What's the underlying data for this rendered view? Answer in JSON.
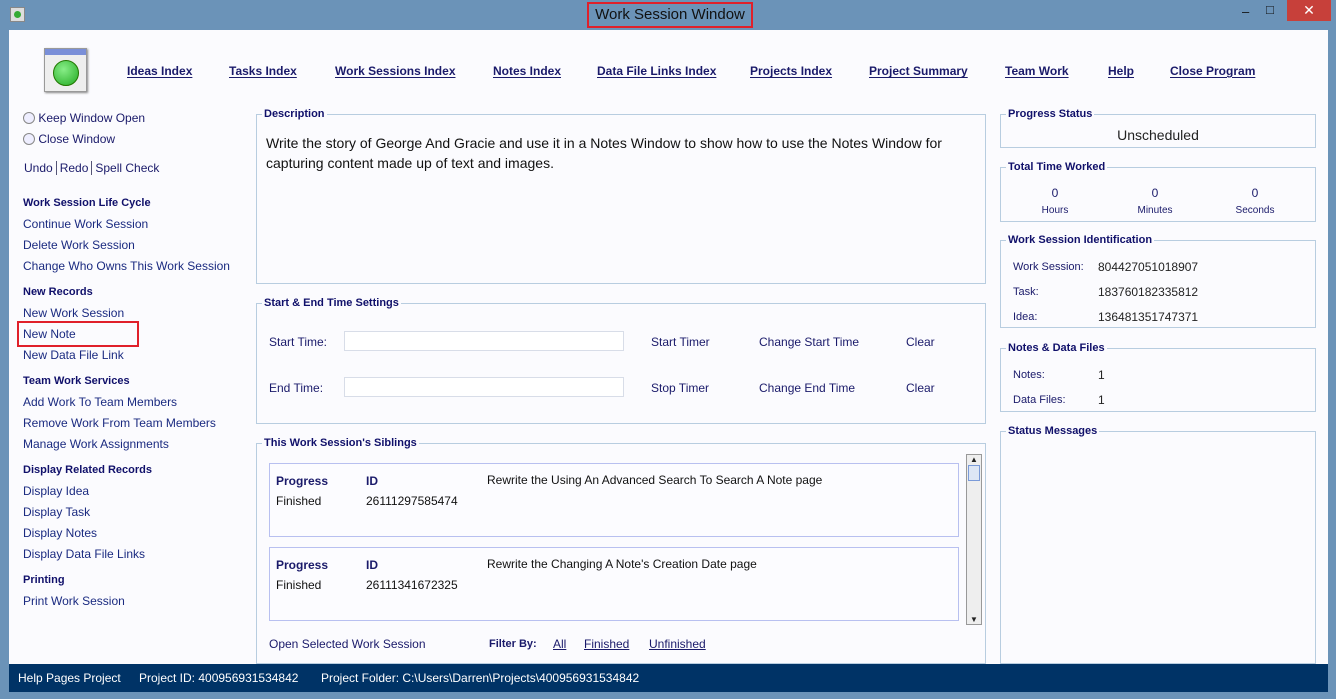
{
  "window": {
    "title": "Work Session Window",
    "minimize": "–",
    "maximize": "□",
    "close": "✕"
  },
  "nav": [
    "Ideas Index",
    "Tasks Index",
    "Work Sessions Index",
    "Notes Index",
    "Data File Links Index",
    "Projects Index",
    "Project Summary",
    "Team Work",
    "Help",
    "Close Program"
  ],
  "left": {
    "radio_keep": "Keep Window Open",
    "radio_close": "Close Window",
    "undo": "Undo",
    "redo": "Redo",
    "spell": "Spell Check",
    "sections": [
      {
        "title": "Work Session Life Cycle",
        "items": [
          "Continue Work Session",
          "Delete Work Session",
          "Change Who Owns This Work Session"
        ]
      },
      {
        "title": "New Records",
        "items": [
          "New Work Session",
          "New Note",
          "New Data File Link"
        ]
      },
      {
        "title": "Team Work Services",
        "items": [
          "Add Work To Team Members",
          "Remove Work From Team Members",
          "Manage Work Assignments"
        ]
      },
      {
        "title": "Display Related Records",
        "items": [
          "Display Idea",
          "Display Task",
          "Display Notes",
          "Display Data File Links"
        ]
      },
      {
        "title": "Printing",
        "items": [
          "Print Work Session"
        ]
      }
    ]
  },
  "description": {
    "label": "Description",
    "text": "Write the story of George And Gracie and use it in a Notes Window to show how to use the Notes Window for capturing content made up of text and images."
  },
  "times": {
    "label": "Start & End Time Settings",
    "start_label": "Start Time:",
    "end_label": "End Time:",
    "start_value": "",
    "end_value": "",
    "start_timer": "Start Timer",
    "stop_timer": "Stop Timer",
    "change_start": "Change Start Time",
    "change_end": "Change End Time",
    "clear": "Clear"
  },
  "siblings": {
    "label": "This Work Session's Siblings",
    "progress_label": "Progress",
    "id_label": "ID",
    "rows": [
      {
        "progress": "Finished",
        "id": "26111297585474",
        "title": "Rewrite the Using An Advanced Search To Search A Note page"
      },
      {
        "progress": "Finished",
        "id": "26111341672325",
        "title": "Rewrite the Changing A Note's Creation Date page"
      }
    ],
    "open": "Open Selected Work Session",
    "filter_label": "Filter By:",
    "filters": [
      "All",
      "Finished",
      "Unfinished"
    ]
  },
  "right": {
    "progress_label": "Progress Status",
    "progress": "Unscheduled",
    "time_label": "Total Time Worked",
    "hours": "0",
    "minutes": "0",
    "seconds": "0",
    "hours_label": "Hours",
    "minutes_label": "Minutes",
    "seconds_label": "Seconds",
    "ident_label": "Work Session Identification",
    "ws_label": "Work Session:",
    "ws": "804427051018907",
    "task_label": "Task:",
    "task": "183760182335812",
    "idea_label": "Idea:",
    "idea": "136481351747371",
    "files_label": "Notes & Data Files",
    "notes_label": "Notes:",
    "notes": "1",
    "data_label": "Data Files:",
    "data": "1",
    "status_label": "Status Messages"
  },
  "statusbar": {
    "project": "Help Pages Project",
    "project_id": "Project ID:  400956931534842",
    "folder": "Project Folder: C:\\Users\\Darren\\Projects\\400956931534842"
  },
  "colors": {
    "frame": "#6b93b8",
    "statusbar": "#003366",
    "highlight": "#e0202a"
  }
}
